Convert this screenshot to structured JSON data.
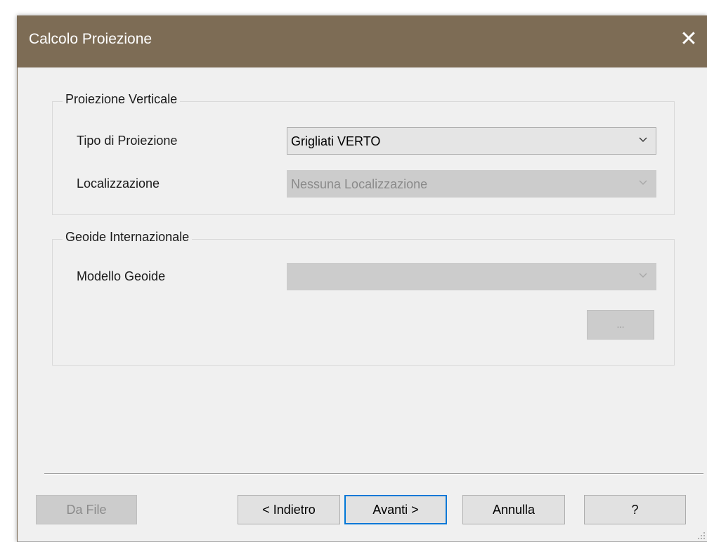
{
  "dialog": {
    "title": "Calcolo Proiezione",
    "close_glyph": "✕"
  },
  "vertical_projection": {
    "group_title": "Proiezione Verticale",
    "projection_type_label": "Tipo di Proiezione",
    "projection_type_value": "Grigliati VERTO",
    "localization_label": "Localizzazione",
    "localization_value": "Nessuna Localizzazione"
  },
  "geoid": {
    "group_title": "Geoide Internazionale",
    "model_label": "Modello Geoide",
    "model_value": "",
    "browse_label": "..."
  },
  "footer": {
    "from_file_label": "Da File",
    "back_label": "< Indietro",
    "next_label": "Avanti >",
    "cancel_label": "Annulla",
    "help_label": "?"
  },
  "colors": {
    "titlebar": "#7d6c55",
    "window_bg": "#f0f0f0",
    "focus_border": "#0078d7",
    "disabled_fill": "#cccccc",
    "disabled_text": "#8a8a8a"
  },
  "icons": {
    "close": "close-icon",
    "dropdown": "chevron-down-icon",
    "resize": "resize-grip-icon"
  }
}
